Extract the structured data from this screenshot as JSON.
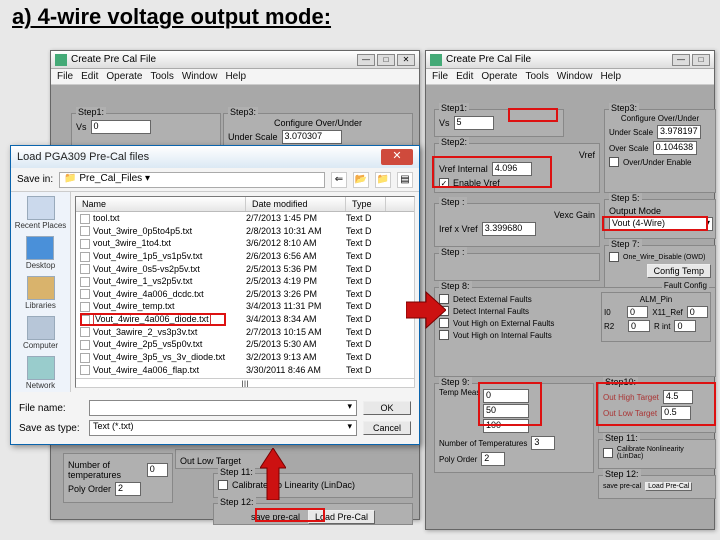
{
  "title": "a) 4-wire voltage output mode:",
  "left_win": {
    "title": "Create Pre Cal File",
    "menus": [
      "File",
      "Edit",
      "Operate",
      "Tools",
      "Window",
      "Help"
    ],
    "step1": {
      "label": "Step1:",
      "vs_label": "Vs",
      "vs": "0"
    },
    "step3": {
      "label": "Step3:",
      "cfg": "Configure Over/Under",
      "us_label": "Under Scale",
      "us": "3.070307"
    },
    "number_of_temps_label": "Number of temperatures",
    "number_of_temps": "0",
    "poly_label": "Poly Order",
    "poly": "2",
    "out_low_label": "Out Low Target",
    "step11": {
      "label": "Step 11:",
      "chk": "Calibrate No Linearity (LinDac)"
    },
    "step12": {
      "label": "Step 12:",
      "save_precal": "save pre-cal",
      "load_precal": "Load Pre-Cal"
    }
  },
  "right_win": {
    "title": "Create Pre Cal File",
    "menus": [
      "File",
      "Edit",
      "Operate",
      "Tools",
      "Window",
      "Help"
    ],
    "step1": {
      "label": "Step1:",
      "vs_label": "Vs",
      "vs": "5"
    },
    "step2": {
      "label": "Step2:",
      "vref_label": "Vref",
      "vref_int_label": "Vref Internal",
      "vref_int": "4.096",
      "enable_vref": "Enable Vref",
      "enable_vref_checked": "✓"
    },
    "step3": {
      "label": "Step3:",
      "cfg": "Configure Over/Under",
      "us_label": "Under Scale",
      "us": "3.978197",
      "os_label": "Over Scale",
      "os": "0.104638",
      "ou_enable": "Over/Under Enable"
    },
    "vexc_label": "Vexc Gain",
    "ivref_label": "Iref x Vref",
    "ivref": "3.399680",
    "step5": {
      "label": "Step 5:",
      "om_label": "Output Mode",
      "om": "Vout (4-Wire)"
    },
    "step7": {
      "label": "Step 7:",
      "owd": "One_Wire_Disable (OWD)",
      "btn": "Config Temp"
    },
    "step8": {
      "label": "Step 8:",
      "fault_cfg": "Fault Config",
      "f1": "Detect External Faults",
      "f2": "Detect Internal Faults",
      "f3": "Vout High on External Faults",
      "f4": "Vout High on Internal Faults",
      "alm_label": "ALM_Pin",
      "i0": "I0",
      "x11": "X11_Ref",
      "r2": "R2",
      "rint": "R int",
      "i0v": "0",
      "x11v": "0",
      "r2v": "0",
      "rintv": "0"
    },
    "step9": {
      "label": "Step 9:",
      "temp_meas": "Temp Meas",
      "t1": "0",
      "t2": "50",
      "t3": "100",
      "nt_label": "Number of Temperatures",
      "nt": "3",
      "poly_label": "Poly Order",
      "poly": "2"
    },
    "step10": {
      "label": "Step10:",
      "oht_label": "Out High Target",
      "oht": "4.5",
      "olt_label": "Out Low Target",
      "olt": "0.5"
    },
    "step11": {
      "label": "Step 11:",
      "chk": "Calibrate Nonlinearity (LinDac)"
    },
    "step12": {
      "label": "Step 12:",
      "save": "save pre-cal",
      "load": "Load Pre-Cal"
    }
  },
  "file_dialog": {
    "title": "Load PGA309 Pre-Cal files",
    "savein_label": "Save in:",
    "folder": "Pre_Cal_Files",
    "places": [
      "Recent Places",
      "Desktop",
      "Libraries",
      "Computer",
      "Network"
    ],
    "columns": [
      "Name",
      "Date modified",
      "Type"
    ],
    "files": [
      {
        "n": "tool.txt",
        "d": "2/7/2013 1:45 PM",
        "t": "Text D"
      },
      {
        "n": "Vout_3wire_0p5to4p5.txt",
        "d": "2/8/2013 10:31 AM",
        "t": "Text D"
      },
      {
        "n": "vout_3wire_1to4.txt",
        "d": "3/6/2012 8:10 AM",
        "t": "Text D"
      },
      {
        "n": "Vout_4wire_1p5_vs1p5v.txt",
        "d": "2/6/2013 6:56 AM",
        "t": "Text D"
      },
      {
        "n": "Vout_4wire_0s5-vs2p5v.txt",
        "d": "2/5/2013 5:36 PM",
        "t": "Text D"
      },
      {
        "n": "Vout_4wire_1_vs2p5v.txt",
        "d": "2/5/2013 4:19 PM",
        "t": "Text D"
      },
      {
        "n": "Vout_4wire_4a006_dcdc.txt",
        "d": "2/5/2013 3:26 PM",
        "t": "Text D"
      },
      {
        "n": "Vout_4wire_temp.txt",
        "d": "3/4/2013 11:31 PM",
        "t": "Text D"
      },
      {
        "n": "Vout_4wire_4a006_diode.txt",
        "d": "3/4/2013 8:34 AM",
        "t": "Text D",
        "sel": true
      },
      {
        "n": "Vout_3awire_2_vs3p3v.txt",
        "d": "2/7/2013 10:15 AM",
        "t": "Text D"
      },
      {
        "n": "Vout_4wire_2p5_vs5p0v.txt",
        "d": "2/5/2013 5:30 AM",
        "t": "Text D"
      },
      {
        "n": "Vout_4wire_3p5_vs_3v_diode.txt",
        "d": "3/2/2013 9:13 AM",
        "t": "Text D"
      },
      {
        "n": "Vout_4wire_4a006_flap.txt",
        "d": "3/30/2011 8:46 AM",
        "t": "Text D"
      }
    ],
    "scroll_hint": "III",
    "file_name_label": "File name:",
    "save_as_type_label": "Save as type:",
    "save_as_type": "Text  (*.txt)",
    "ok": "OK",
    "cancel": "Cancel"
  }
}
